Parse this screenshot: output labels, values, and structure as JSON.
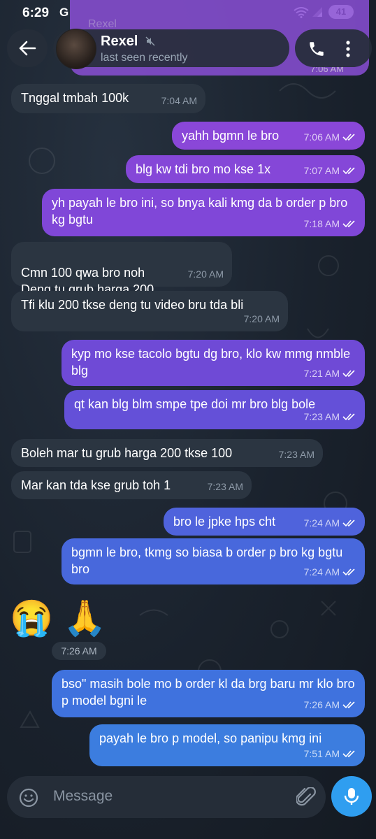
{
  "status_bar": {
    "time": "6:29",
    "carrier_icon": "G",
    "battery": "41"
  },
  "pinned_preview": {
    "sender": "Rexel",
    "time": "7:06 AM"
  },
  "header": {
    "name": "Rexel",
    "status": "last seen recently"
  },
  "messages": [
    {
      "dir": "in",
      "text": "Tnggal tmbah 100k",
      "time": "7:04 AM"
    },
    {
      "dir": "out",
      "text": "yahh bgmn le bro",
      "time": "7:06 AM"
    },
    {
      "dir": "out",
      "text": "blg kw tdi bro mo kse 1x",
      "time": "7:07 AM"
    },
    {
      "dir": "out",
      "text": "yh payah le bro ini, so bnya kali kmg da b order p bro kg bgtu",
      "time": "7:18 AM"
    },
    {
      "dir": "in",
      "text": "Cmn 100 qwa bro noh\nDeng tu grub harga 200",
      "time": "7:20 AM"
    },
    {
      "dir": "in",
      "text": "Tfi klu 200 tkse deng tu video bru tda bli",
      "time": "7:20 AM"
    },
    {
      "dir": "out",
      "text": "kyp mo kse tacolo bgtu dg bro, klo kw mmg nmble blg",
      "time": "7:21 AM"
    },
    {
      "dir": "out",
      "text": "qt kan blg blm smpe tpe doi mr bro blg bole",
      "time": "7:23 AM"
    },
    {
      "dir": "in",
      "text": "Boleh mar tu grub harga 200 tkse 100",
      "time": "7:23 AM"
    },
    {
      "dir": "in",
      "text": "Mar kan tda kse grub toh 1",
      "time": "7:23 AM"
    },
    {
      "dir": "out",
      "text": "bro le jpke hps cht",
      "time": "7:24 AM"
    },
    {
      "dir": "out",
      "text": "bgmn le bro, tkmg so biasa b order p bro kg bgtu bro",
      "time": "7:24 AM"
    },
    {
      "dir": "in",
      "emoji": "😭 🙏",
      "time": "7:26 AM"
    },
    {
      "dir": "out",
      "text": "bso\" masih bole mo b order kl da brg baru mr klo bro p model bgni le",
      "time": "7:26 AM"
    },
    {
      "dir": "out",
      "text": "payah le bro p model, so panipu kmg ini",
      "time": "7:51 AM"
    }
  ],
  "composer": {
    "placeholder": "Message"
  },
  "colors": {
    "outgoing_top": "#7b45d3",
    "outgoing_bottom": "#3c7ddf",
    "incoming": "#2b3541",
    "accent": "#2f9ef0"
  }
}
